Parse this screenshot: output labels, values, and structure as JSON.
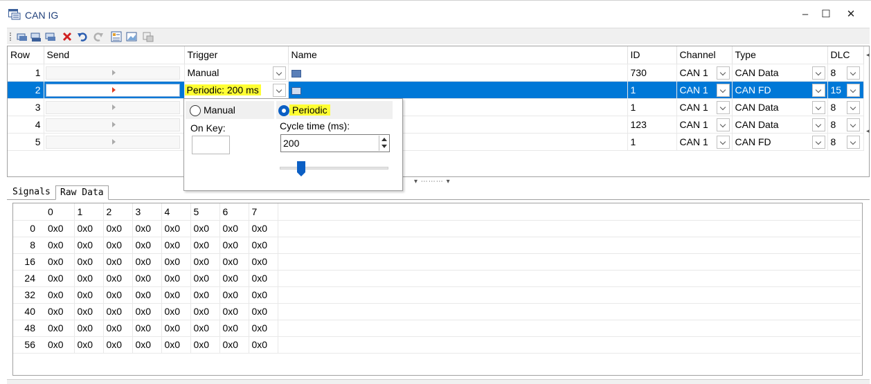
{
  "window": {
    "title": "CAN IG",
    "minimize": "–",
    "maximize": "☐",
    "close": "✕"
  },
  "toolbar": {
    "icons": [
      "add-can-message-icon",
      "add-canfd-message-icon",
      "add-frame-icon",
      "delete-icon",
      "undo-icon",
      "redo-icon",
      "properties-icon",
      "image-icon",
      "settings-icon"
    ]
  },
  "grid": {
    "columns": [
      "Row",
      "Send",
      "Trigger",
      "Name",
      "ID",
      "Channel",
      "Type",
      "DLC"
    ],
    "rows": [
      {
        "row": "1",
        "trigger": "Manual",
        "id": "730",
        "channel": "CAN 1",
        "type": "CAN Data",
        "dlc": "8"
      },
      {
        "row": "2",
        "trigger": "Periodic: 200 ms",
        "id": "1",
        "channel": "CAN 1",
        "type": "CAN FD",
        "dlc": "15",
        "selected": true
      },
      {
        "row": "3",
        "trigger": "",
        "id": "1",
        "channel": "CAN 1",
        "type": "CAN Data",
        "dlc": "8"
      },
      {
        "row": "4",
        "trigger": "",
        "id": "123",
        "channel": "CAN 1",
        "type": "CAN Data",
        "dlc": "8"
      },
      {
        "row": "5",
        "trigger": "",
        "id": "1",
        "channel": "CAN 1",
        "type": "CAN FD",
        "dlc": "8"
      }
    ],
    "highlight_color": "#0078d7"
  },
  "popup": {
    "manual_label": "Manual",
    "periodic_label": "Periodic",
    "selected_mode": "Periodic",
    "on_key_label": "On Key:",
    "cycle_label": "Cycle time (ms):",
    "cycle_value": "200",
    "slider_fraction": 0.2
  },
  "tabs": [
    "Signals",
    "Raw Data"
  ],
  "active_tab": "Raw Data",
  "raw": {
    "headers": [
      "0",
      "1",
      "2",
      "3",
      "4",
      "5",
      "6",
      "7"
    ],
    "offsets": [
      "0",
      "8",
      "16",
      "24",
      "32",
      "40",
      "48",
      "56"
    ],
    "cell_value": "0x0"
  }
}
